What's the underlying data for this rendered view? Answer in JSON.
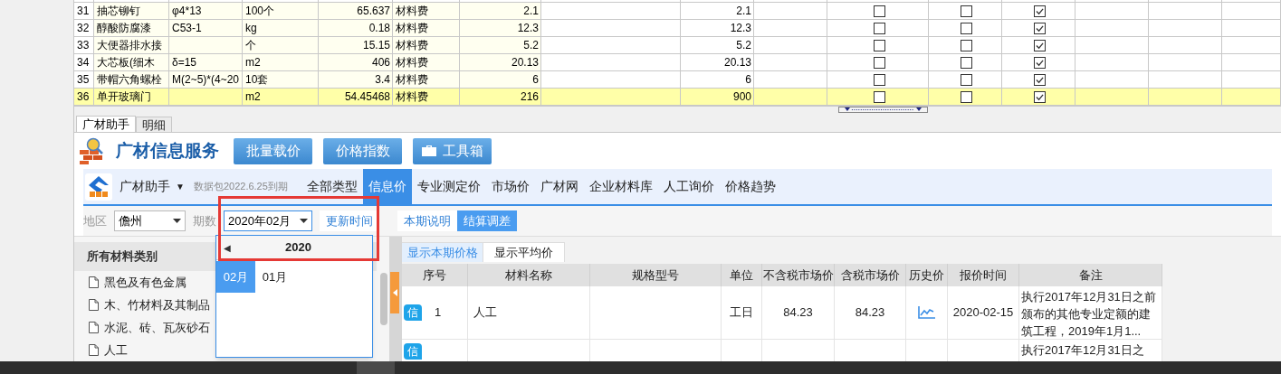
{
  "grid": {
    "rows": [
      {
        "no": "31",
        "name": "抽芯铆钉",
        "spec": "φ4*13",
        "unit": "100个",
        "price": "65.637",
        "type": "材料费",
        "column_7": "2.1",
        "column_9": "2.1",
        "checks": [
          false,
          false,
          true
        ],
        "highlighted": false
      },
      {
        "no": "32",
        "name": "醇酸防腐漆",
        "spec": "C53-1",
        "unit": "kg",
        "price": "0.18",
        "type": "材料费",
        "column_7": "12.3",
        "column_9": "12.3",
        "checks": [
          false,
          false,
          true
        ],
        "highlighted": false
      },
      {
        "no": "33",
        "name": "大便器排水接",
        "spec": "",
        "unit": "个",
        "price": "15.15",
        "type": "材料费",
        "column_7": "5.2",
        "column_9": "5.2",
        "checks": [
          false,
          false,
          true
        ],
        "highlighted": false
      },
      {
        "no": "34",
        "name": "大芯板(细木",
        "spec": "δ=15",
        "unit": "m2",
        "price": "406",
        "type": "材料费",
        "column_7": "20.13",
        "column_9": "20.13",
        "checks": [
          false,
          false,
          true
        ],
        "highlighted": false
      },
      {
        "no": "35",
        "name": "带帽六角螺栓",
        "spec": "M(2~5)*(4~20",
        "unit": "10套",
        "price": "3.4",
        "type": "材料费",
        "column_7": "6",
        "column_9": "6",
        "checks": [
          false,
          false,
          true
        ],
        "highlighted": false
      },
      {
        "no": "36",
        "name": "单开玻璃门",
        "spec": "",
        "unit": "m2",
        "price": "54.45468",
        "type": "材料费",
        "column_7": "216",
        "column_9": "900",
        "checks": [
          false,
          false,
          true
        ],
        "highlighted": true
      }
    ]
  },
  "panel_tabs": [
    {
      "label": "广材助手",
      "selected": true
    },
    {
      "label": "明细",
      "selected": false
    }
  ],
  "header": {
    "title": "广材信息服务",
    "buttons": [
      {
        "label": "批量载价",
        "kind": "plain"
      },
      {
        "label": "价格指数",
        "kind": "plain"
      },
      {
        "label": "工具箱",
        "kind": "toolbox"
      }
    ]
  },
  "nav": {
    "app": "广材助手",
    "caret": "▼",
    "notice": "数据包2022.6.25到期",
    "items": [
      {
        "label": "全部类型",
        "selected": false
      },
      {
        "label": "信息价",
        "selected": true
      },
      {
        "label": "专业测定价",
        "selected": false
      },
      {
        "label": "市场价",
        "selected": false
      },
      {
        "label": "广材网",
        "selected": false
      },
      {
        "label": "企业材料库",
        "selected": false
      },
      {
        "label": "人工询价",
        "selected": false
      },
      {
        "label": "价格趋势",
        "selected": false
      }
    ]
  },
  "filters": {
    "region_label": "地区",
    "region": "儋州",
    "period_label": "期数",
    "period": "2020年02月",
    "buttons": [
      {
        "label": "更新时间",
        "selected": false
      },
      {
        "label": "本期说明",
        "selected": false
      },
      {
        "label": "结算调差",
        "selected": true
      }
    ]
  },
  "period_popup": {
    "prev": "◀",
    "year": "2020",
    "months": [
      {
        "label": "02月",
        "selected": true
      },
      {
        "label": "01月",
        "selected": false
      }
    ]
  },
  "categories": {
    "title": "所有材料类别",
    "items": [
      "黑色及有色金属",
      "木、竹材料及其制品",
      "水泥、砖、瓦灰砂石",
      "人工"
    ]
  },
  "price_tabs": [
    {
      "label": "显示本期价格",
      "selected": true
    },
    {
      "label": "显示平均价",
      "selected": false
    }
  ],
  "price_table": {
    "columns": [
      "序号",
      "材料名称",
      "规格型号",
      "单位",
      "不含税市场价",
      "含税市场价",
      "历史价",
      "报价时间",
      "备注"
    ],
    "rows": [
      {
        "badge": "信",
        "no": "1",
        "name": "人工",
        "spec": "",
        "unit": "工日",
        "price_ex_tax": "84.23",
        "price_tax": "84.23",
        "history": true,
        "date": "2020-02-15",
        "note": "执行2017年12月31日之前颁布的其他专业定额的建筑工程，2019年1月1..."
      },
      {
        "badge": "信",
        "note": "执行2017年12月31日之"
      }
    ]
  }
}
